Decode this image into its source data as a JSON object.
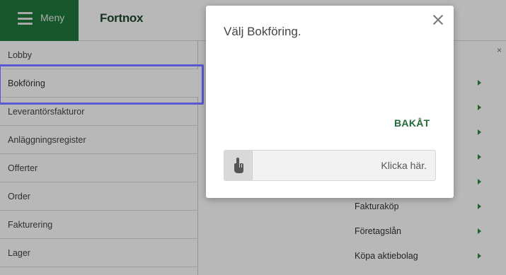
{
  "topbar": {
    "menu_label": "Meny",
    "logo": "Fortnox"
  },
  "sidebar": {
    "items": [
      {
        "label": "Lobby"
      },
      {
        "label": "Bokföring"
      },
      {
        "label": "Leverantörsfakturor"
      },
      {
        "label": "Anläggningsregister"
      },
      {
        "label": "Offerter"
      },
      {
        "label": "Order"
      },
      {
        "label": "Fakturering"
      },
      {
        "label": "Lager"
      }
    ]
  },
  "content": {
    "close_label": "×",
    "rows": [
      {
        "label": ""
      },
      {
        "label": ""
      },
      {
        "label": ""
      },
      {
        "label": ""
      },
      {
        "label": ""
      },
      {
        "label": "Fakturaköp"
      },
      {
        "label": "Företagslån"
      },
      {
        "label": "Köpa aktiebolag"
      }
    ]
  },
  "modal": {
    "title": "Välj Bokföring.",
    "back_label": "BAKÅT",
    "click_text": "Klicka här."
  },
  "colors": {
    "brand_green": "#1f7a3d",
    "highlight": "#5b59d1",
    "arrow_green": "#2e8b3e"
  }
}
